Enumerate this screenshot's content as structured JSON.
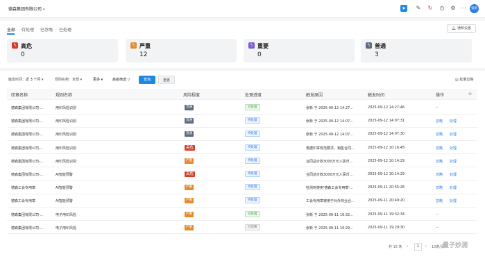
{
  "header": {
    "company": "德森集团有限公司",
    "avatar_text": "张新",
    "icons": [
      "send-icon",
      "edit-icon",
      "refresh-icon",
      "clock-icon",
      "gear-icon",
      "more-icon"
    ]
  },
  "tabs": [
    {
      "label": "全部",
      "active": true
    },
    {
      "label": "待处理",
      "active": false
    },
    {
      "label": "已忽略",
      "active": false
    },
    {
      "label": "已处理",
      "active": false
    }
  ],
  "notify_settings_label": "通知设置",
  "summary_cards": [
    {
      "label": "高危",
      "count": "0",
      "color": "#d93b2b"
    },
    {
      "label": "严重",
      "count": "12",
      "color": "#e38b2d"
    },
    {
      "label": "重要",
      "count": "0",
      "color": "#7b5cd6"
    },
    {
      "label": "普通",
      "count": "3",
      "color": "#5f6b80"
    }
  ],
  "filters": {
    "time_label": "触发时间：",
    "time_value": "近 3 个月",
    "rule_label": "规则名称：",
    "rule_value": "全部",
    "more": "更多",
    "advanced": "高级筛选",
    "query": "查询",
    "reset": "重置",
    "batch": "批量忽略"
  },
  "table": {
    "columns": [
      "印章名称",
      "规则名称",
      "风险程度",
      "处理进度",
      "触发原因",
      "触发时间",
      "操作"
    ],
    "rows": [
      {
        "seal": "德森集团有限公司-...",
        "rule": "用印风险识别",
        "risk": "普通",
        "risk_level": "general",
        "status": "已处理",
        "status_type": "done",
        "reason": "张新 于 2025-09-12 14:27...",
        "time": "2025-09-12 14:27:46",
        "ops": [
          "--"
        ]
      },
      {
        "seal": "德森集团有限公司-...",
        "rule": "用印风险识别",
        "risk": "普通",
        "risk_level": "general",
        "status": "待处理",
        "status_type": "pending",
        "reason": "张新 于 2025-09-12 14:07...",
        "time": "2025-09-12 14:07:31",
        "ops": [
          "忽略",
          "处理"
        ]
      },
      {
        "seal": "德森集团有限公司-...",
        "rule": "用印风险识别",
        "risk": "普通",
        "risk_level": "general",
        "status": "待处理",
        "status_type": "pending",
        "reason": "张新 于 2025-09-12 14:07...",
        "time": "2025-09-12 14:07:30",
        "ops": [
          "忽略",
          "处理"
        ]
      },
      {
        "seal": "德森集团有限公司-...",
        "rule": "用印风险识别",
        "risk": "高危",
        "risk_level": "high",
        "status": "待处理",
        "status_type": "pending",
        "reason": "根据印章规范要求，销售合同...",
        "time": "2025-09-12 10:16:45",
        "ops": [
          "忽略",
          "处理"
        ]
      },
      {
        "seal": "德森集团有限公司-...",
        "rule": "用印风险识别",
        "risk": "严重",
        "risk_level": "severe",
        "status": "待处理",
        "status_type": "pending",
        "reason": "合同总价款3000万元人民币...",
        "time": "2025-09-12 10:14:29",
        "ops": [
          "忽略",
          "处理"
        ]
      },
      {
        "seal": "德森集团有限公司-...",
        "rule": "AI智能预警",
        "risk": "高危",
        "risk_level": "high",
        "status": "待处理",
        "status_type": "pending",
        "reason": "合同总价款3000万元人民币...",
        "time": "2025-09-12 10:14:29",
        "ops": [
          "忽略",
          "处理"
        ]
      },
      {
        "seal": "德森工会专用章",
        "rule": "AI智能预警",
        "risk": "严重",
        "risk_level": "severe",
        "status": "待处理",
        "status_type": "pending",
        "reason": "检测到使用'德森工会专用章'...",
        "time": "2025-09-11 20:55:26",
        "ops": [
          "忽略",
          "处理"
        ]
      },
      {
        "seal": "德森工会专用章",
        "rule": "AI智能预警",
        "risk": "严重",
        "risk_level": "severe",
        "status": "待处理",
        "status_type": "pending",
        "reason": "工会专用章被用于对外商业合...",
        "time": "2025-09-11 20:49:20",
        "ops": [
          "忽略",
          "处理"
        ]
      },
      {
        "seal": "德森集团有限公司-...",
        "rule": "电子用印风险",
        "risk": "严重",
        "risk_level": "severe",
        "status": "已处理",
        "status_type": "done",
        "reason": "张新 于 2025-09-11 19:32...",
        "time": "2025-09-11 19:32:34",
        "ops": [
          "--"
        ]
      },
      {
        "seal": "德森集团有限公司-...",
        "rule": "电子用印风险",
        "risk": "严重",
        "risk_level": "severe",
        "status": "已忽略",
        "status_type": "ignored",
        "reason": "张新 于 2025-09-11 19:29...",
        "time": "2025-09-11 19:29:30",
        "ops": [
          "--"
        ]
      }
    ]
  },
  "pagination": {
    "total": "共 15 条",
    "page": "1",
    "page_size": "10条/页"
  },
  "watermark": "量子妙测"
}
